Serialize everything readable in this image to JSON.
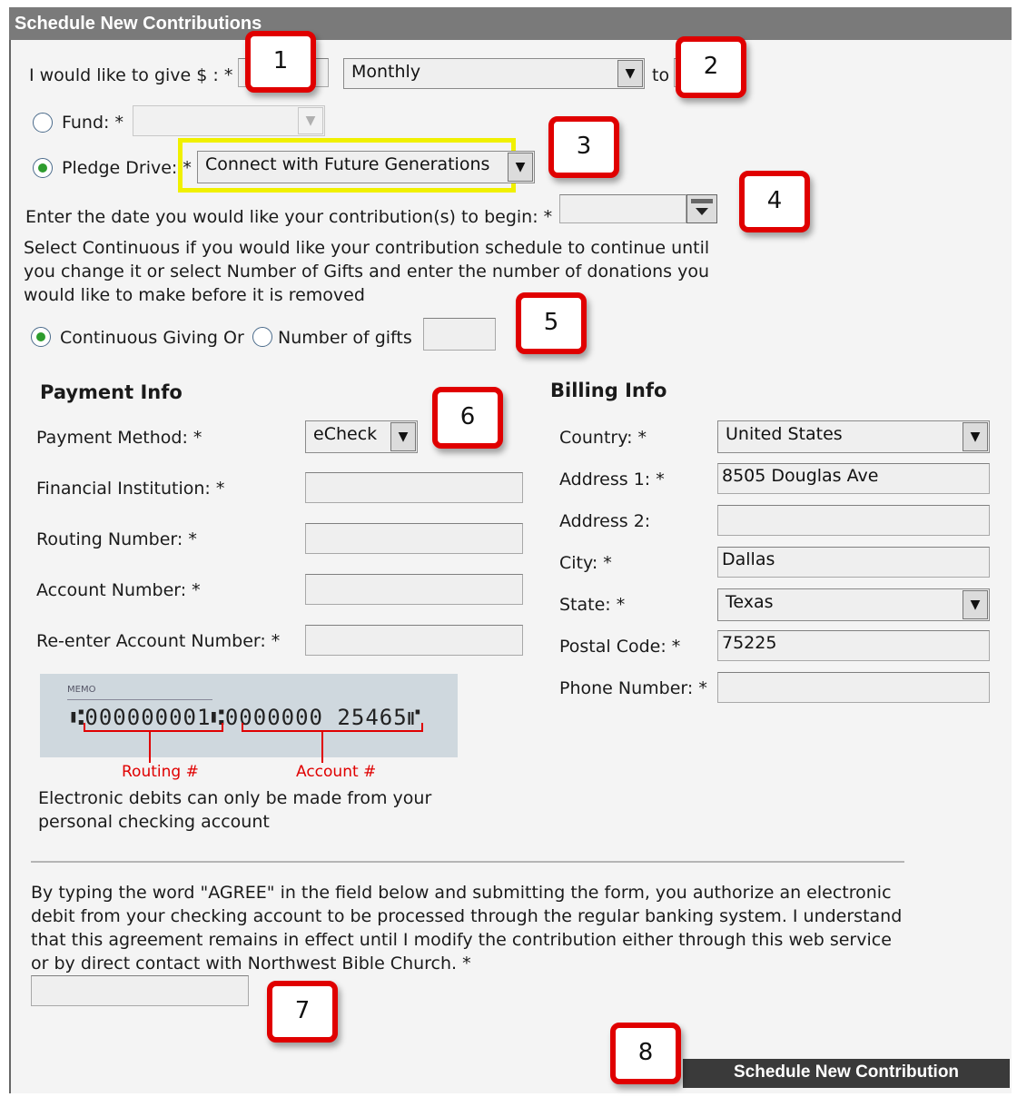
{
  "header": {
    "title": "Schedule New Contributions"
  },
  "give": {
    "label": "I would like to give $ : *",
    "frequency": "Monthly",
    "to_label": "to"
  },
  "fund": {
    "label": "Fund: *",
    "value": ""
  },
  "pledge": {
    "label": "Pledge Drive: *",
    "value": "Connect with Future Generations"
  },
  "start_date": {
    "label": "Enter the date you would like your contribution(s) to begin: *",
    "value": ""
  },
  "schedule_help": "Select Continuous if you would like your contribution schedule to continue until you change it or select Number of Gifts and enter the number of donations you would like to make before it is removed",
  "continuous": {
    "label": "Continuous Giving Or"
  },
  "num_gifts": {
    "label": "Number of gifts",
    "value": ""
  },
  "payment": {
    "title": "Payment Info",
    "method_label": "Payment Method: *",
    "method_value": "eCheck",
    "institution_label": "Financial Institution: *",
    "routing_label": "Routing Number: *",
    "account_label": "Account Number: *",
    "reenter_label": "Re-enter Account Number: *",
    "check_memo": "MEMO",
    "check_numbers": "⑆000000001⑆0000000 25465⑈",
    "routing_caption": "Routing #",
    "account_caption": "Account #",
    "note": "Electronic debits can only be made from your personal checking account"
  },
  "billing": {
    "title": "Billing Info",
    "country_label": "Country: *",
    "country_value": "United States",
    "address1_label": "Address 1: *",
    "address1_value": "8505 Douglas Ave",
    "address2_label": "Address 2:",
    "address2_value": "",
    "city_label": "City: *",
    "city_value": "Dallas",
    "state_label": "State: *",
    "state_value": "Texas",
    "postal_label": "Postal Code: *",
    "postal_value": "75225",
    "phone_label": "Phone Number: *",
    "phone_value": ""
  },
  "agreement": {
    "text": "By typing the word \"AGREE\" in the field below and submitting the form, you authorize an electronic debit from your checking account to be processed through the regular banking system. I understand that this agreement remains in effect until I modify the contribution either through this web service or by direct contact with Northwest Bible Church. *",
    "value": ""
  },
  "submit_label": "Schedule New Contribution",
  "callouts": [
    "1",
    "2",
    "3",
    "4",
    "5",
    "6",
    "7",
    "8"
  ],
  "colors": {
    "callout_border": "#e00000",
    "highlight": "#f0f000",
    "radio_selected": "#2e9c2e"
  }
}
